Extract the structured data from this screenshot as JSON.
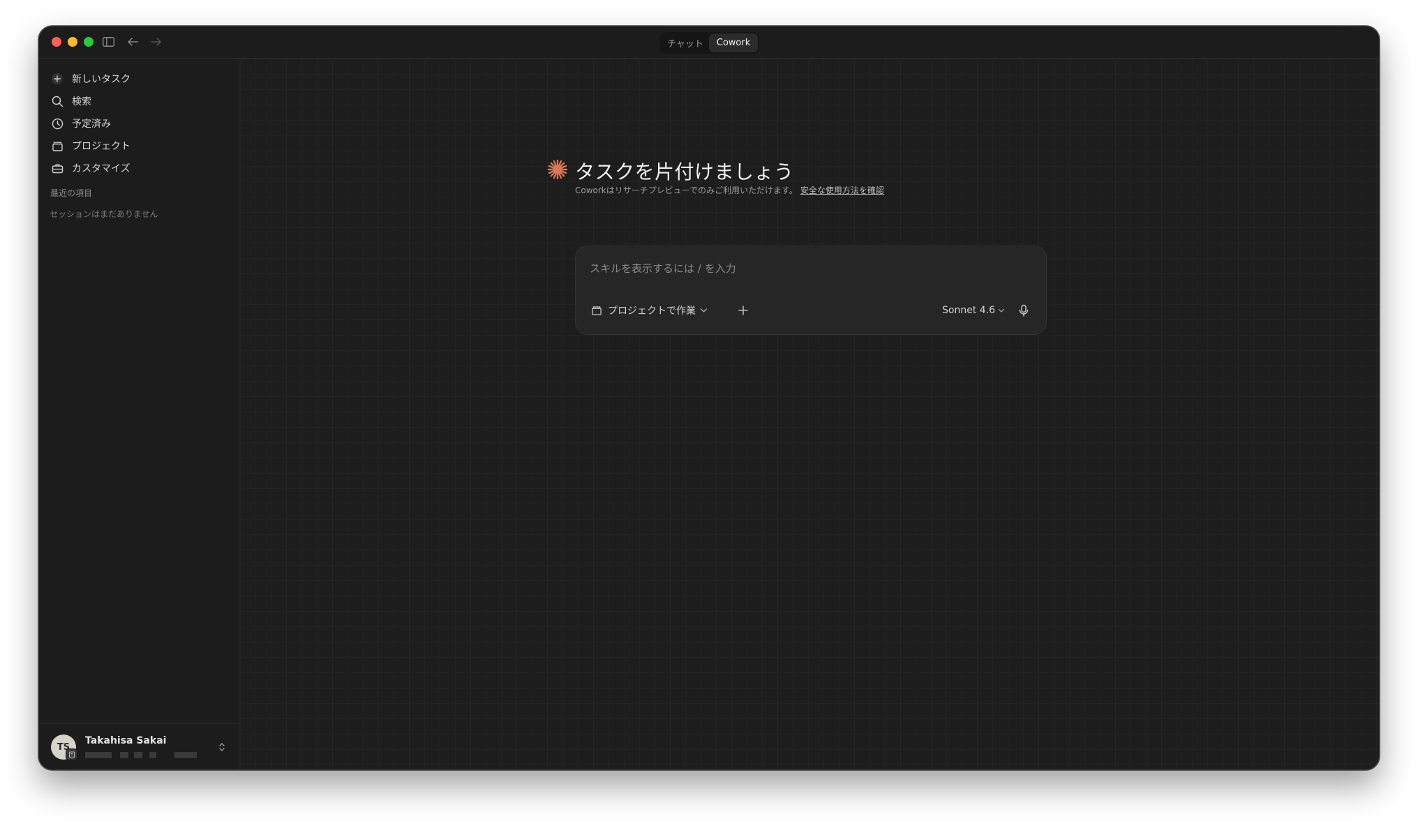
{
  "titlebar": {
    "tabs": [
      {
        "label": "チャット",
        "active": false
      },
      {
        "label": "Cowork",
        "active": true
      }
    ]
  },
  "sidebar": {
    "items": [
      {
        "label": "新しいタスク",
        "icon": "plus-circle-icon"
      },
      {
        "label": "検索",
        "icon": "search-icon"
      },
      {
        "label": "予定済み",
        "icon": "clock-icon"
      },
      {
        "label": "プロジェクト",
        "icon": "folder-icon"
      },
      {
        "label": "カスタマイズ",
        "icon": "toolbox-icon"
      }
    ],
    "recent_title": "最近の項目",
    "recent_empty": "セッションはまだありません"
  },
  "user": {
    "initials": "TS",
    "name": "Takahisa Sakai"
  },
  "main": {
    "title": "タスクを片付けましょう",
    "subtitle": "Coworkはリサーチプレビューでのみご利用いただけます。",
    "subtitle_link": "安全な使用方法を確認",
    "input_placeholder": "スキルを表示するには / を入力",
    "project_button": "プロジェクトで作業",
    "model": "Sonnet 4.6"
  },
  "colors": {
    "accent": "#d97757",
    "background": "#1d1d1d",
    "sidebar": "#1c1c1c"
  }
}
